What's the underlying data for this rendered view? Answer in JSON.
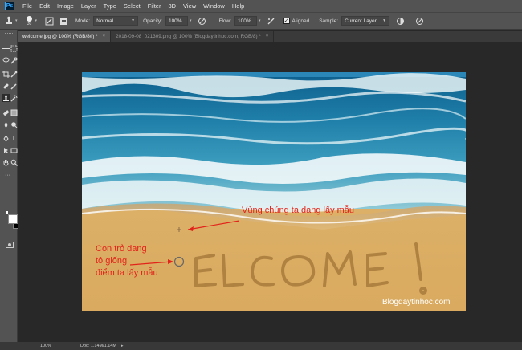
{
  "menubar": {
    "items": [
      "File",
      "Edit",
      "Image",
      "Layer",
      "Type",
      "Select",
      "Filter",
      "3D",
      "View",
      "Window",
      "Help"
    ]
  },
  "options": {
    "brush_size": "30",
    "mode_label": "Mode:",
    "mode_value": "Normal",
    "opacity_label": "Opacity:",
    "opacity_value": "100%",
    "flow_label": "Flow:",
    "flow_value": "100%",
    "aligned_label": "Aligned",
    "sample_label": "Sample:",
    "sample_value": "Current Layer"
  },
  "tabs": [
    {
      "label": "welcome.jpg @ 100% (RGB/8#) *",
      "close": "×"
    },
    {
      "label": "2018-09-08_021309.png @ 100% (Blogdaytinhoc.com, RGB/8) *",
      "close": "×"
    }
  ],
  "status": {
    "zoom": "100%",
    "doc": "Doc: 1.14M/1.14M"
  },
  "annotations": {
    "sample_area": "Vùng chúng ta dang lấy mẫu",
    "cursor_line1": "Con trỏ dang",
    "cursor_line2": "tô giống",
    "cursor_line3": "điểm ta lấy mẫu"
  },
  "watermark": "Blogdaytinhoc.com",
  "colors": {
    "annotation": "#e2231a",
    "foreground": "#ffffff",
    "background": "#000000"
  }
}
